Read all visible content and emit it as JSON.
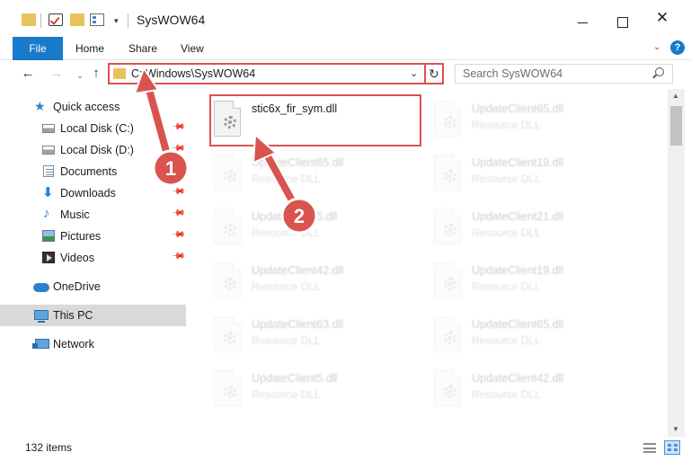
{
  "window": {
    "title": "SysWOW64",
    "qa_dropdown_glyph": "▾",
    "close_glyph": "✕"
  },
  "ribbon": {
    "tabs": [
      "File",
      "Home",
      "Share",
      "View"
    ],
    "expand_glyph": "⌄",
    "help_glyph": "?"
  },
  "navigation": {
    "back_glyph": "←",
    "forward_glyph": "→",
    "recent_glyph": "⌄",
    "up_glyph": "↑",
    "address_path": "C:\\Windows\\SysWOW64",
    "address_dropdown_glyph": "⌄",
    "refresh_glyph": "↻",
    "search_placeholder": "Search SysWOW64"
  },
  "sidebar": {
    "pin_glyph": "📌",
    "items": [
      {
        "label": "Quick access",
        "icon": "star-icon",
        "glyph": "★",
        "pinned": false
      },
      {
        "label": "Local Disk (C:)",
        "icon": "hard-drive-icon",
        "pinned": true
      },
      {
        "label": "Local Disk (D:)",
        "icon": "hard-drive-icon",
        "pinned": true
      },
      {
        "label": "Documents",
        "icon": "documents-icon",
        "pinned": true
      },
      {
        "label": "Downloads",
        "icon": "download-arrow-icon",
        "glyph": "⬇",
        "pinned": true
      },
      {
        "label": "Music",
        "icon": "music-note-icon",
        "glyph": "♪",
        "pinned": true
      },
      {
        "label": "Pictures",
        "icon": "pictures-icon",
        "pinned": true
      },
      {
        "label": "Videos",
        "icon": "videos-icon",
        "pinned": true
      },
      {
        "label": "OneDrive",
        "icon": "cloud-icon",
        "pinned": false
      },
      {
        "label": "This PC",
        "icon": "computer-icon",
        "pinned": false,
        "selected": true
      },
      {
        "label": "Network",
        "icon": "network-icon",
        "pinned": false
      }
    ]
  },
  "files": {
    "highlighted": {
      "name": "stic6x_fir_sym.dll"
    },
    "faded": [
      {
        "name": "UpdateClient65.dll",
        "type": "Resource DLL"
      },
      {
        "name": "UpdateClient65.dll",
        "type": "Resource DLL"
      },
      {
        "name": "UpdateClient19.dll",
        "type": "Resource DLL"
      },
      {
        "name": "UpdateClient5.dll",
        "type": "Resource DLL"
      },
      {
        "name": "UpdateClient21.dll",
        "type": "Resource DLL"
      },
      {
        "name": "UpdateClient42.dll",
        "type": "Resource DLL"
      },
      {
        "name": "UpdateClient19.dll",
        "type": "Resource DLL"
      },
      {
        "name": "UpdateClient63.dll",
        "type": "Resource DLL"
      },
      {
        "name": "UpdateClient65.dll",
        "type": "Resource DLL"
      },
      {
        "name": "UpdateClient5.dll",
        "type": "Resource DLL"
      },
      {
        "name": "UpdateClient42.dll",
        "type": "Resource DLL"
      }
    ]
  },
  "scrollbar": {
    "up_glyph": "▲",
    "down_glyph": "▼"
  },
  "status": {
    "item_count": "132 items"
  },
  "annotations": {
    "badge_1": "1",
    "badge_2": "2",
    "color": "#d9534f"
  },
  "colors": {
    "accent": "#1979ca",
    "highlight": "#d9534f",
    "folder": "#e8c25a"
  }
}
